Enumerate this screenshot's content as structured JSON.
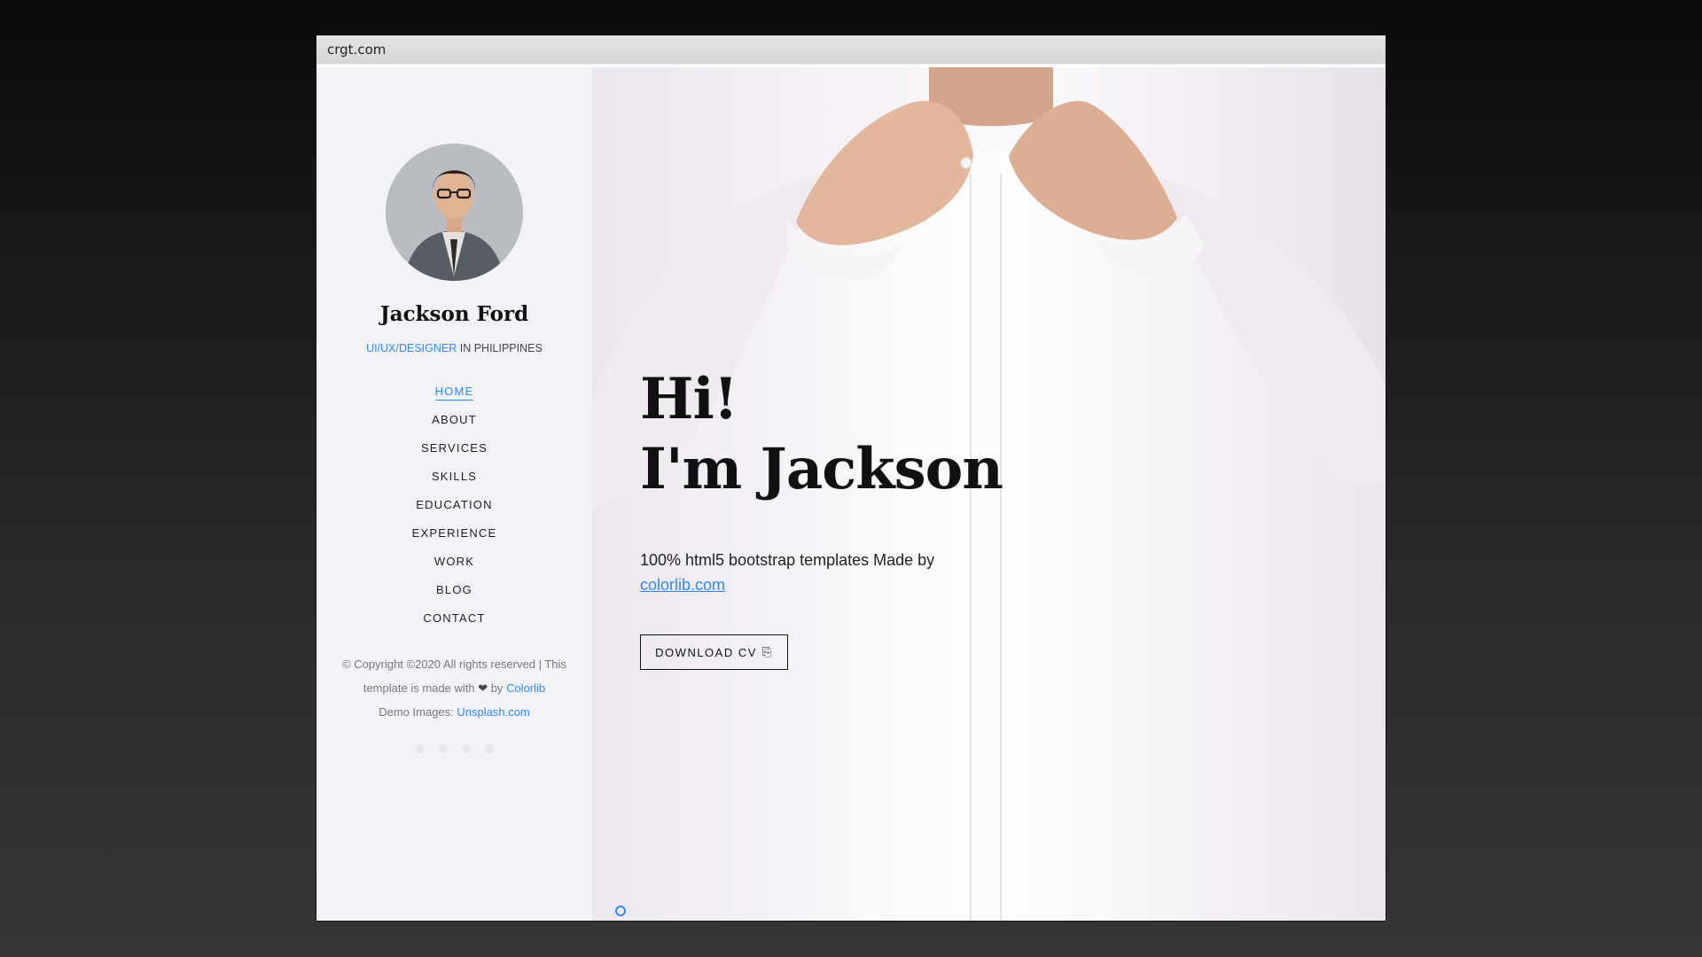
{
  "browser": {
    "url": "crgt.com"
  },
  "sidebar": {
    "name": "Jackson Ford",
    "role_accent": "UI/UX/DESIGNER",
    "role_rest": " IN PHILIPPINES",
    "nav": [
      {
        "label": "HOME",
        "active": true
      },
      {
        "label": "ABOUT"
      },
      {
        "label": "SERVICES"
      },
      {
        "label": "SKILLS"
      },
      {
        "label": "EDUCATION"
      },
      {
        "label": "EXPERIENCE"
      },
      {
        "label": "WORK"
      },
      {
        "label": "BLOG"
      },
      {
        "label": "CONTACT"
      }
    ],
    "footer": {
      "copyright_a": "© Copyright ©2020 All rights reserved | This template is made with ",
      "heart": "❤",
      "copyright_b": " by ",
      "colorlib": "Colorlib",
      "demo_label": "Demo Images: ",
      "unsplash": "Unsplash.com"
    }
  },
  "hero": {
    "line1": "Hi!",
    "line2": "I'm Jackson",
    "tagline_a": "100% html5 bootstrap templates Made by ",
    "tagline_link": "colorlib.com",
    "cta_label": "DOWNLOAD CV",
    "cta_icon": "download-icon"
  },
  "colors": {
    "accent": "#2f89fc",
    "sidebar_bg": "#f2f3f7",
    "text": "#111111"
  },
  "slider": {
    "count": 2,
    "active_index": 0
  }
}
